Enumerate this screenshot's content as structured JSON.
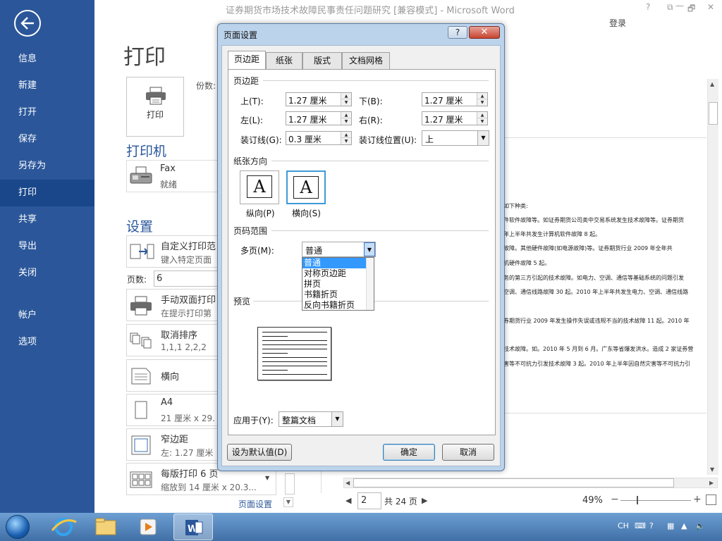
{
  "window": {
    "title": "证券期货市场技术故障民事责任问题研究 [兼容模式] - Microsoft Word",
    "login": "登录",
    "controls": {
      "help": "?",
      "minimize": "—",
      "restore": "🗗",
      "close": "✕"
    }
  },
  "sidebar": {
    "items": [
      {
        "label": "信息"
      },
      {
        "label": "新建"
      },
      {
        "label": "打开"
      },
      {
        "label": "保存"
      },
      {
        "label": "另存为"
      },
      {
        "label": "打印"
      },
      {
        "label": "共享"
      },
      {
        "label": "导出"
      },
      {
        "label": "关闭"
      },
      {
        "label": "帐户"
      },
      {
        "label": "选项"
      }
    ],
    "active": "打印"
  },
  "print": {
    "heading": "打印",
    "print_button": "打印",
    "copies_label": "份数:",
    "printer_heading": "打印机",
    "printer_name": "Fax",
    "printer_status": "就绪",
    "settings_heading": "设置",
    "setting1_title": "自定义打印范",
    "setting1_sub": "键入特定页面",
    "pages_label": "页数:",
    "pages_value": "6",
    "setting2_title": "手动双面打印",
    "setting2_sub": "在提示打印第",
    "setting3_title": "取消排序",
    "setting3_sub": "1,1,1    2,2,2",
    "setting4_title": "横向",
    "setting5_title": "A4",
    "setting5_sub": "21 厘米 x 29.",
    "setting6_title": "窄边距",
    "setting6_sub": "左: 1.27 厘米",
    "setting7_title": "每版打印 6 页",
    "setting7_sub": "缩放到 14 厘米 x 20.3...",
    "page_setup_link": "页面设置"
  },
  "preview": {
    "lines": [
      "如下种类:",
      "件软件故障等。如证券期货公司类中交易系统发生技术故障等。证券期货",
      "年上半年共发生计算机软件故障 8 起。",
      "故障。其他硬件故障(如电源故障)等。证券期货行业 2009 年全年共",
      "机硬件故障 5 起。",
      "务的第三方引起的技术故障。如电力、空调、通信等基础系统的问题引发",
      "空调、通信线路故障 30 起。2010 年上半年共发生电力、空调、通信线路",
      "券期货行业 2009 年发生操作失误或违规不当的技术故障 11 起。2010 年",
      "技术故障。如。2010 年 5 月到 6 月。广东等省爆发洪水。造成 2 家证券营",
      "害等不可抗力引发技术故障 3 起。2010 年上半年因自然灾害等不可抗力引"
    ],
    "current_page": "2",
    "total_pages": "共 24 页",
    "zoom": "49%"
  },
  "dialog": {
    "title": "页面设置",
    "help": "?",
    "close": "✕",
    "tabs": [
      {
        "label": "页边距"
      },
      {
        "label": "纸张"
      },
      {
        "label": "版式"
      },
      {
        "label": "文档网格"
      }
    ],
    "margins_group": "页边距",
    "top_label": "上(T):",
    "top_value": "1.27 厘米",
    "bottom_label": "下(B):",
    "bottom_value": "1.27 厘米",
    "left_label": "左(L):",
    "left_value": "1.27 厘米",
    "right_label": "右(R):",
    "right_value": "1.27 厘米",
    "gutter_label": "装订线(G):",
    "gutter_value": "0.3 厘米",
    "gutter_pos_label": "装订线位置(U):",
    "gutter_pos_value": "上",
    "orientation_group": "纸张方向",
    "portrait_label": "纵向(P)",
    "landscape_label": "横向(S)",
    "orientation_glyph": "A",
    "pages_group": "页码范围",
    "multiple_pages_label": "多页(M):",
    "multiple_pages_value": "普通",
    "multiple_pages_options": [
      "普通",
      "对称页边距",
      "拼页",
      "书籍折页",
      "反向书籍折页"
    ],
    "preview_group": "预览",
    "apply_to_label": "应用于(Y):",
    "apply_to_value": "整篇文档",
    "set_default": "设为默认值(D)",
    "ok": "确定",
    "cancel": "取消"
  },
  "taskbar": {
    "tray": {
      "lang": "CH"
    }
  },
  "colors": {
    "sidebar": "#2b579a",
    "sidebar_active": "#19478a",
    "accent": "#2b579a"
  }
}
